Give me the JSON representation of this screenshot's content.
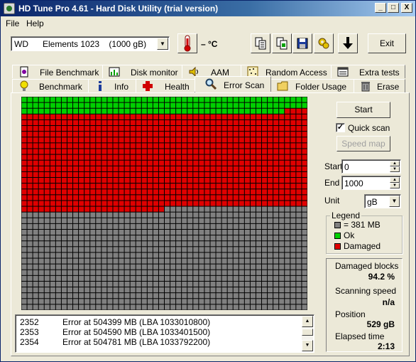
{
  "window": {
    "title": "HD Tune Pro 4.61 - Hard Disk Utility (trial version)",
    "minimize": "_",
    "maximize": "□",
    "close": "X"
  },
  "menu": {
    "file": "File",
    "help": "Help"
  },
  "toolbar": {
    "drive": "WD      Elements 1023    (1000 gB)",
    "temperature": "– °C",
    "exit_label": "Exit",
    "icons": [
      "thermometer-icon",
      "copy-text-icon",
      "copy-image-icon",
      "save-icon",
      "options-icon",
      "download-icon"
    ]
  },
  "tabs": {
    "top_row": [
      "File Benchmark",
      "Disk monitor",
      "AAM",
      "Random Access",
      "Extra tests"
    ],
    "bottom_row": [
      "Benchmark",
      "Info",
      "Health",
      "Error Scan",
      "Folder Usage",
      "Erase"
    ],
    "active": "Error Scan"
  },
  "controls": {
    "start_label": "Start",
    "quick_scan_label": "Quick scan",
    "quick_scan_checked": true,
    "speed_map_label": "Speed map",
    "start_field_label": "Start",
    "start_value": "0",
    "end_field_label": "End",
    "end_value": "1000",
    "unit_label": "Unit",
    "unit_value": "gB"
  },
  "legend": {
    "title": "Legend",
    "items": [
      {
        "label": "= 381 MB",
        "color": "#808080"
      },
      {
        "label": "Ok",
        "color": "#00d000"
      },
      {
        "label": "Damaged",
        "color": "#e00000"
      }
    ]
  },
  "stats": {
    "damaged_label": "Damaged blocks",
    "damaged_value": "94.2 %",
    "speed_label": "Scanning speed",
    "speed_value": "n/a",
    "position_label": "Position",
    "position_value": "529 gB",
    "elapsed_label": "Elapsed time",
    "elapsed_value": "2:13"
  },
  "log": [
    {
      "index": "2352",
      "message": "Error at 504399 MB (LBA 1033010800)"
    },
    {
      "index": "2353",
      "message": "Error at 504590 MB (LBA 1033401500)"
    },
    {
      "index": "2354",
      "message": "Error at 504781 MB (LBA 1033792200)"
    }
  ],
  "block_map": {
    "colors": {
      "ok": "#00d000",
      "damaged": "#e00000",
      "unscanned": "#808080",
      "gap": "#000000"
    },
    "columns": 50,
    "rows": 37,
    "states": {
      "ok_full_rows": 2,
      "ok_partial_columns": 46,
      "damaged_full_rows_end": 19,
      "damaged_partial_columns": 25
    }
  }
}
